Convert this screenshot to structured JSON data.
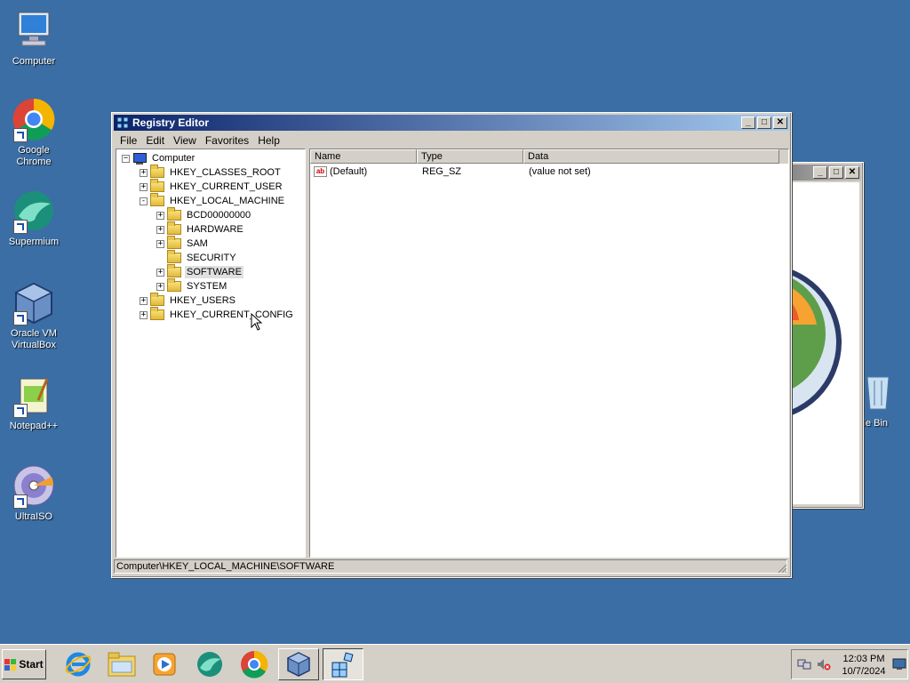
{
  "desktop": {
    "icons": [
      {
        "label": "Computer"
      },
      {
        "label": "Google Chrome"
      },
      {
        "label": "Supermium"
      },
      {
        "label": "Oracle VM VirtualBox"
      },
      {
        "label": "Notepad++"
      },
      {
        "label": "UltraISO"
      }
    ],
    "partial_label": "cle Bin"
  },
  "registry_window": {
    "title": "Registry Editor",
    "menu": [
      "File",
      "Edit",
      "View",
      "Favorites",
      "Help"
    ],
    "tree": {
      "root": "Computer",
      "items": [
        {
          "label": "HKEY_CLASSES_ROOT",
          "expander": "+"
        },
        {
          "label": "HKEY_CURRENT_USER",
          "expander": "+"
        },
        {
          "label": "HKEY_LOCAL_MACHINE",
          "expander": "-"
        },
        {
          "label": "BCD00000000",
          "expander": "+"
        },
        {
          "label": "HARDWARE",
          "expander": "+"
        },
        {
          "label": "SAM",
          "expander": "+"
        },
        {
          "label": "SECURITY",
          "expander": ""
        },
        {
          "label": "SOFTWARE",
          "expander": "+"
        },
        {
          "label": "SYSTEM",
          "expander": "+"
        },
        {
          "label": "HKEY_USERS",
          "expander": "+"
        },
        {
          "label": "HKEY_CURRENT_CONFIG",
          "expander": "+"
        }
      ],
      "selected": "SOFTWARE"
    },
    "columns": [
      "Name",
      "Type",
      "Data"
    ],
    "rows": [
      {
        "name": "(Default)",
        "type": "REG_SZ",
        "data": "(value not set)"
      }
    ],
    "status": "Computer\\HKEY_LOCAL_MACHINE\\SOFTWARE",
    "buttons": {
      "minimize": "_",
      "maximize": "□",
      "close": "✕"
    }
  },
  "taskbar": {
    "start_label": "Start",
    "time": "12:03 PM",
    "date": "10/7/2024"
  }
}
